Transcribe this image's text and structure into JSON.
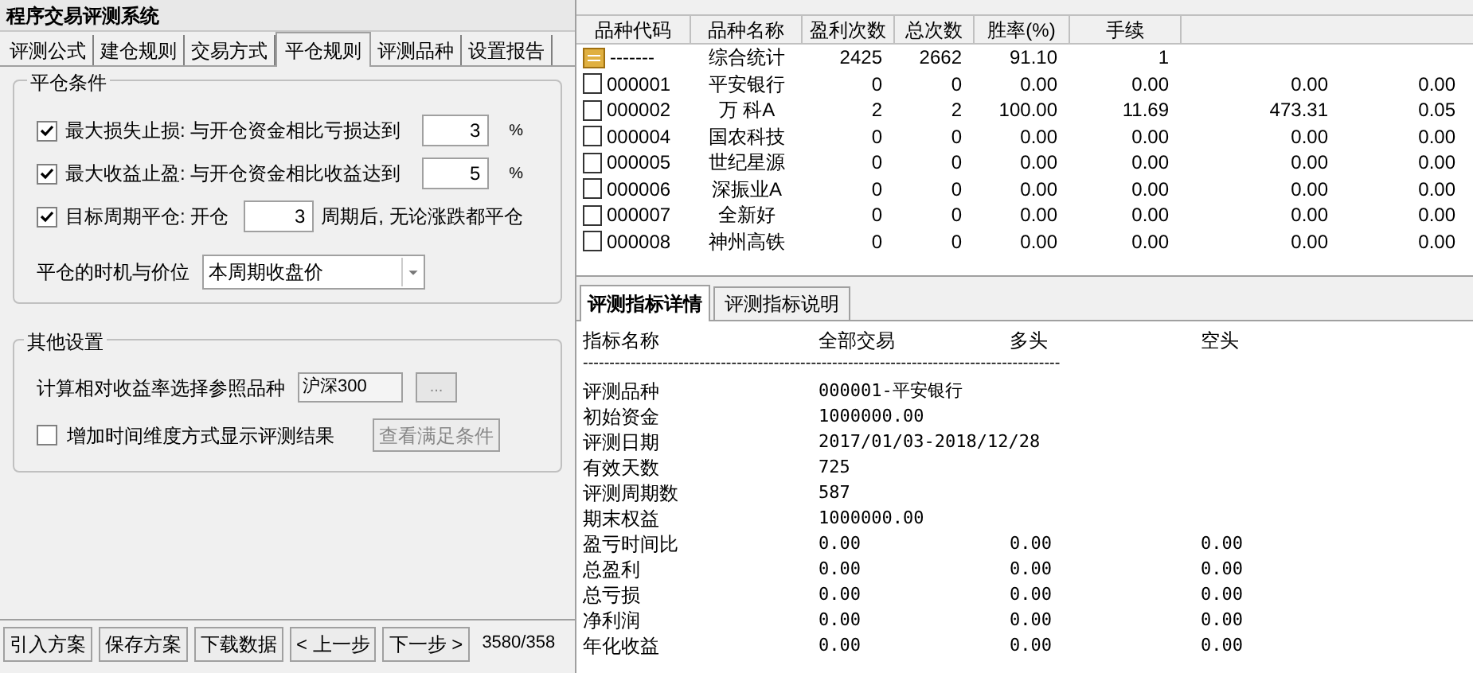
{
  "window": {
    "title": "程序交易评测系统"
  },
  "tabs": [
    {
      "label": "评测公式",
      "selected": false
    },
    {
      "label": "建仓规则",
      "selected": false
    },
    {
      "label": "交易方式",
      "selected": false
    },
    {
      "label": "平仓规则",
      "selected": true
    },
    {
      "label": "评测品种",
      "selected": false
    },
    {
      "label": "设置报告",
      "selected": false
    }
  ],
  "close_conditions": {
    "title": "平仓条件",
    "rows": [
      {
        "kind": "percent",
        "checked": true,
        "label": "最大损失止损: 与开仓资金相比亏损达到",
        "value": "3",
        "unit": "%"
      },
      {
        "kind": "percent",
        "checked": true,
        "label": "最大收益止盈: 与开仓资金相比收益达到",
        "value": "5",
        "unit": "%"
      },
      {
        "kind": "period",
        "checked": true,
        "label": "目标周期平仓: 开仓",
        "value": "3",
        "unit": "周期后, 无论涨跌都平仓"
      }
    ],
    "timing_label": "平仓的时机与价位",
    "timing_value": "本周期收盘价"
  },
  "other_settings": {
    "title": "其他设置",
    "reference_label": "计算相对收益率选择参照品种",
    "reference_value": "沪深300",
    "browse_button": "...",
    "time_dimension": {
      "checked": false,
      "label": "增加时间维度方式显示评测结果"
    },
    "view_button": "查看满足条件"
  },
  "bottom_buttons": [
    "引入方案",
    "保存方案",
    "下载数据",
    "< 上一步",
    "下一步 >"
  ],
  "progress_text": "3580/358",
  "results_table": {
    "columns": [
      "品种代码",
      "品种名称",
      "盈利次数",
      "总次数",
      "胜率(%)",
      "手续"
    ],
    "rows": [
      {
        "kind": "summary",
        "cells": [
          "-------",
          "综合统计",
          "2425",
          "2662",
          "91.10",
          "1"
        ]
      },
      {
        "kind": "stock",
        "cells": [
          "000001",
          "平安银行",
          "0",
          "0",
          "0.00",
          "0.00",
          "0.00",
          "0.00"
        ]
      },
      {
        "kind": "stock",
        "cells": [
          "000002",
          "万 科A",
          "2",
          "2",
          "100.00",
          "11.69",
          "473.31",
          "0.05"
        ]
      },
      {
        "kind": "stock",
        "cells": [
          "000004",
          "国农科技",
          "0",
          "0",
          "0.00",
          "0.00",
          "0.00",
          "0.00"
        ]
      },
      {
        "kind": "stock",
        "cells": [
          "000005",
          "世纪星源",
          "0",
          "0",
          "0.00",
          "0.00",
          "0.00",
          "0.00"
        ]
      },
      {
        "kind": "stock",
        "cells": [
          "000006",
          "深振业A",
          "0",
          "0",
          "0.00",
          "0.00",
          "0.00",
          "0.00"
        ]
      },
      {
        "kind": "stock",
        "cells": [
          "000007",
          "全新好",
          "0",
          "0",
          "0.00",
          "0.00",
          "0.00",
          "0.00"
        ]
      },
      {
        "kind": "stock",
        "cells": [
          "000008",
          "神州高铁",
          "0",
          "0",
          "0.00",
          "0.00",
          "0.00",
          "0.00"
        ]
      }
    ]
  },
  "detail_tabs": [
    {
      "label": "评测指标详情",
      "selected": true
    },
    {
      "label": "评测指标说明",
      "selected": false
    }
  ],
  "detail": {
    "columns": [
      "指标名称",
      "全部交易",
      "多头",
      "空头"
    ],
    "separator": "------------------------------------------------------------------------------------------",
    "rows": [
      [
        "评测品种",
        "000001-平安银行"
      ],
      [
        "初始资金",
        "1000000.00"
      ],
      [
        "评测日期",
        "2017/01/03-2018/12/28"
      ],
      [
        "有效天数",
        "725"
      ],
      [
        "评测周期数",
        "587"
      ],
      [
        "期末权益",
        "1000000.00"
      ],
      [
        "盈亏时间比",
        "0.00",
        "0.00",
        "0.00"
      ],
      [
        "总盈利",
        "0.00",
        "0.00",
        "0.00"
      ],
      [
        "总亏损",
        "0.00",
        "0.00",
        "0.00"
      ],
      [
        "净利润",
        "0.00",
        "0.00",
        "0.00"
      ],
      [
        "年化收益",
        "0.00",
        "0.00",
        "0.00"
      ]
    ]
  }
}
